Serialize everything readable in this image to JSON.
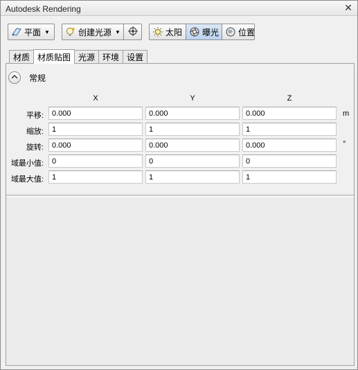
{
  "window": {
    "title": "Autodesk Rendering",
    "close_glyph": "✕"
  },
  "toolbar": {
    "plane_label": "平面",
    "create_light_label": "创建光源",
    "sun_label": "太阳",
    "exposure_label": "曝光",
    "location_label": "位置",
    "caret": "▼",
    "icons": [
      "plane-icon",
      "create-light-icon",
      "target-light-icon",
      "sun-icon",
      "exposure-icon",
      "location-icon"
    ]
  },
  "tabs": [
    {
      "label": "材质",
      "selected": false
    },
    {
      "label": "材质贴图",
      "selected": true
    },
    {
      "label": "光源",
      "selected": false
    },
    {
      "label": "环境",
      "selected": false
    },
    {
      "label": "设置",
      "selected": false
    }
  ],
  "section": {
    "title": "常规",
    "collapse_glyph": "︿"
  },
  "grid": {
    "columns": [
      "X",
      "Y",
      "Z"
    ],
    "rows": [
      {
        "label": "平移:",
        "values": [
          "0.000",
          "0.000",
          "0.000"
        ],
        "unit": "m"
      },
      {
        "label": "缩放:",
        "values": [
          "1",
          "1",
          "1"
        ],
        "unit": ""
      },
      {
        "label": "旋转:",
        "values": [
          "0.000",
          "0.000",
          "0.000"
        ],
        "unit": "°"
      },
      {
        "label": "域最小值:",
        "values": [
          "0",
          "0",
          "0"
        ],
        "unit": ""
      },
      {
        "label": "域最大值:",
        "values": [
          "1",
          "1",
          "1"
        ],
        "unit": ""
      }
    ]
  },
  "colors": {
    "active_accent": "#5b87c0",
    "window_bg": "#f0f0f0"
  }
}
